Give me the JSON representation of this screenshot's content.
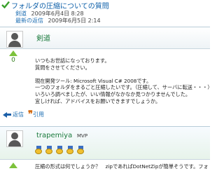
{
  "thread": {
    "title": "フォルダの圧縮についての質問",
    "meta": [
      {
        "key": "剣道",
        "value": "2009年6月4日 8:28"
      },
      {
        "key": "最新の返信",
        "value": "2009年6月5日 2:14"
      }
    ]
  },
  "posts": [
    {
      "author": "剣道",
      "votes": "0",
      "body": [
        "いつもお世話になっております。",
        "質問をさせてください。",
        "",
        "現在開発ツール: Microsoft Visual C# 2008です。",
        "一つのフォルダをまるごと圧縮したいです。（圧縮して、サーバに転送・・・）",
        "いろいろ調べましたが、いい情報がなかなか見つかりませんでした。",
        "宜しければ、アドバイスをお願いできますでしょうか。"
      ],
      "actions": {
        "reply": "返信",
        "quote": "引用"
      }
    },
    {
      "author": "trapemiya",
      "badge": "MVP",
      "votes": "0",
      "body": [
        "圧縮の形式は何でしょうか？　zipであればDotNetZipが簡単そうです。フォ"
      ]
    }
  ],
  "colors": {
    "accent": "#1f6fb3",
    "author": "#1a7a3c",
    "vote": "#7cc23a",
    "check": "#3aa02b"
  }
}
